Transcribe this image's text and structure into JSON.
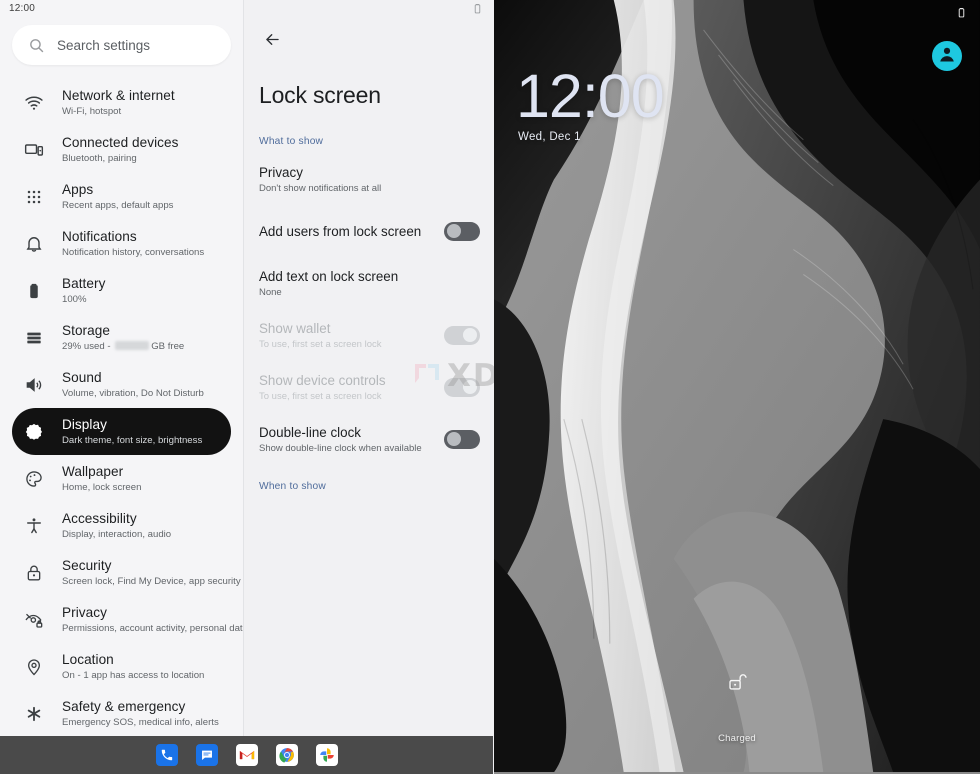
{
  "sidebar": {
    "status_time": "12:00",
    "search": {
      "placeholder": "Search settings",
      "icon": "search-icon"
    },
    "items": [
      {
        "icon": "wifi-icon",
        "title": "Network & internet",
        "subtitle": "Wi-Fi, hotspot",
        "selected": false
      },
      {
        "icon": "devices-icon",
        "title": "Connected devices",
        "subtitle": "Bluetooth, pairing",
        "selected": false
      },
      {
        "icon": "apps-grid-icon",
        "title": "Apps",
        "subtitle": "Recent apps, default apps",
        "selected": false
      },
      {
        "icon": "bell-icon",
        "title": "Notifications",
        "subtitle": "Notification history, conversations",
        "selected": false
      },
      {
        "icon": "battery-icon",
        "title": "Battery",
        "subtitle": "100%",
        "selected": false
      },
      {
        "icon": "storage-icon",
        "title": "Storage",
        "subtitle_pre": "29% used - ",
        "subtitle_post": "GB free",
        "blurred": true,
        "selected": false
      },
      {
        "icon": "volume-icon",
        "title": "Sound",
        "subtitle": "Volume, vibration, Do Not Disturb",
        "selected": false
      },
      {
        "icon": "brightness-icon",
        "title": "Display",
        "subtitle": "Dark theme, font size, brightness",
        "selected": true
      },
      {
        "icon": "palette-icon",
        "title": "Wallpaper",
        "subtitle": "Home, lock screen",
        "selected": false
      },
      {
        "icon": "accessibility-icon",
        "title": "Accessibility",
        "subtitle": "Display, interaction, audio",
        "selected": false
      },
      {
        "icon": "lock-icon",
        "title": "Security",
        "subtitle": "Screen lock, Find My Device, app security",
        "selected": false
      },
      {
        "icon": "eye-off-icon",
        "title": "Privacy",
        "subtitle": "Permissions, account activity, personal data",
        "selected": false
      },
      {
        "icon": "location-pin-icon",
        "title": "Location",
        "subtitle": "On - 1 app has access to location",
        "selected": false
      },
      {
        "icon": "asterisk-icon",
        "title": "Safety & emergency",
        "subtitle": "Emergency SOS, medical info, alerts",
        "selected": false
      }
    ]
  },
  "detail": {
    "back_icon": "back-arrow-icon",
    "status_battery_icon": "battery-icon",
    "title": "Lock screen",
    "section_what_to_show": "What to show",
    "section_when_to_show": "When to show",
    "rows": [
      {
        "title": "Privacy",
        "subtitle": "Don't show notifications at all",
        "control": "none",
        "disabled": false
      },
      {
        "title": "Add users from lock screen",
        "subtitle": "",
        "control": "switch",
        "state": "off",
        "disabled": false
      },
      {
        "title": "Add text on lock screen",
        "subtitle": "None",
        "control": "none",
        "disabled": false
      },
      {
        "title": "Show wallet",
        "subtitle": "To use, first set a screen lock",
        "control": "switch",
        "state": "disabled",
        "disabled": true
      },
      {
        "title": "Show device controls",
        "subtitle": "To use, first set a screen lock",
        "control": "switch",
        "state": "disabled",
        "disabled": true
      },
      {
        "title": "Double-line clock",
        "subtitle": "Show double-line clock when available",
        "control": "switch",
        "state": "off",
        "disabled": false
      }
    ]
  },
  "lockscreen": {
    "status_battery_icon": "battery-icon",
    "avatar_icon": "user-avatar-icon",
    "avatar_color": "#1ec8e0",
    "clock": "12:00",
    "date": "Wed, Dec 1",
    "lock_icon": "unlocked-padlock-icon",
    "charge_status": "Charged"
  },
  "taskbar": {
    "apps": [
      {
        "name": "phone-app-icon",
        "label": "Phone"
      },
      {
        "name": "messages-app-icon",
        "label": "Messages"
      },
      {
        "name": "gmail-app-icon",
        "label": "Gmail"
      },
      {
        "name": "chrome-app-icon",
        "label": "Chrome"
      },
      {
        "name": "photos-app-icon",
        "label": "Photos"
      }
    ]
  },
  "watermark": {
    "text": "XDA"
  }
}
